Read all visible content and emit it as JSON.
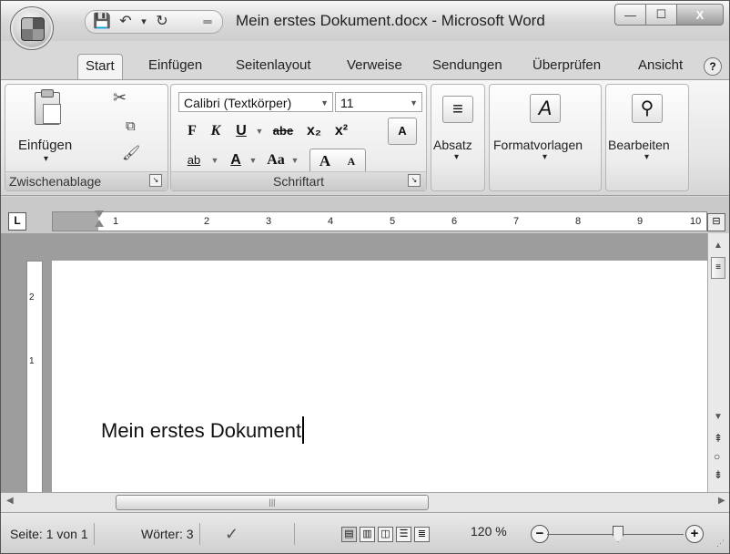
{
  "window": {
    "title": "Mein erstes Dokument.docx - Microsoft Word",
    "controls": {
      "minimize": "—",
      "maximize": "☐",
      "close": "X"
    }
  },
  "quick_access": {
    "save_icon": "💾",
    "undo_icon": "↶",
    "dropdown_icon": "▾",
    "redo_icon": "↻",
    "customize_icon": "═"
  },
  "tabs": [
    "Start",
    "Einfügen",
    "Seitenlayout",
    "Verweise",
    "Sendungen",
    "Überprüfen",
    "Ansicht"
  ],
  "help_icon": "?",
  "ribbon": {
    "clipboard": {
      "paste_label": "Einfügen",
      "paste_arrow": "▾",
      "group_label": "Zwischenablage",
      "cut_icon": "✂",
      "copy_icon": "⧉",
      "format_painter_icon": "🖌"
    },
    "font": {
      "font_name": "Calibri (Textkörper)",
      "font_size": "11",
      "bold": "F",
      "italic": "K",
      "underline": "U",
      "strikethrough": "abe",
      "subscript": "x₂",
      "superscript": "x²",
      "clear_format": "A",
      "highlight": "ab",
      "font_color": "A",
      "change_case": "Aa",
      "grow": "A",
      "shrink": "A",
      "group_label": "Schriftart"
    },
    "paragraph": {
      "label": "Absatz",
      "arrow": "▾",
      "icon": "≡"
    },
    "styles": {
      "label": "Formatvorlagen",
      "arrow": "▾",
      "icon": "A"
    },
    "editing": {
      "label": "Bearbeiten",
      "arrow": "▾",
      "icon": "⚲"
    }
  },
  "ruler": {
    "tab_selector": "L",
    "numbers": [
      "1",
      "2",
      "3",
      "4",
      "5",
      "6",
      "7",
      "8",
      "9",
      "10"
    ],
    "vertical_numbers": [
      "2",
      "1"
    ]
  },
  "document": {
    "text": "Mein erstes Dokument"
  },
  "status": {
    "page": "Seite: 1 von 1",
    "words": "Wörter: 3",
    "proof_icon": "✓",
    "zoom": "120 %",
    "zoom_level_percent": 120,
    "zoom_out": "−",
    "zoom_in": "+"
  }
}
